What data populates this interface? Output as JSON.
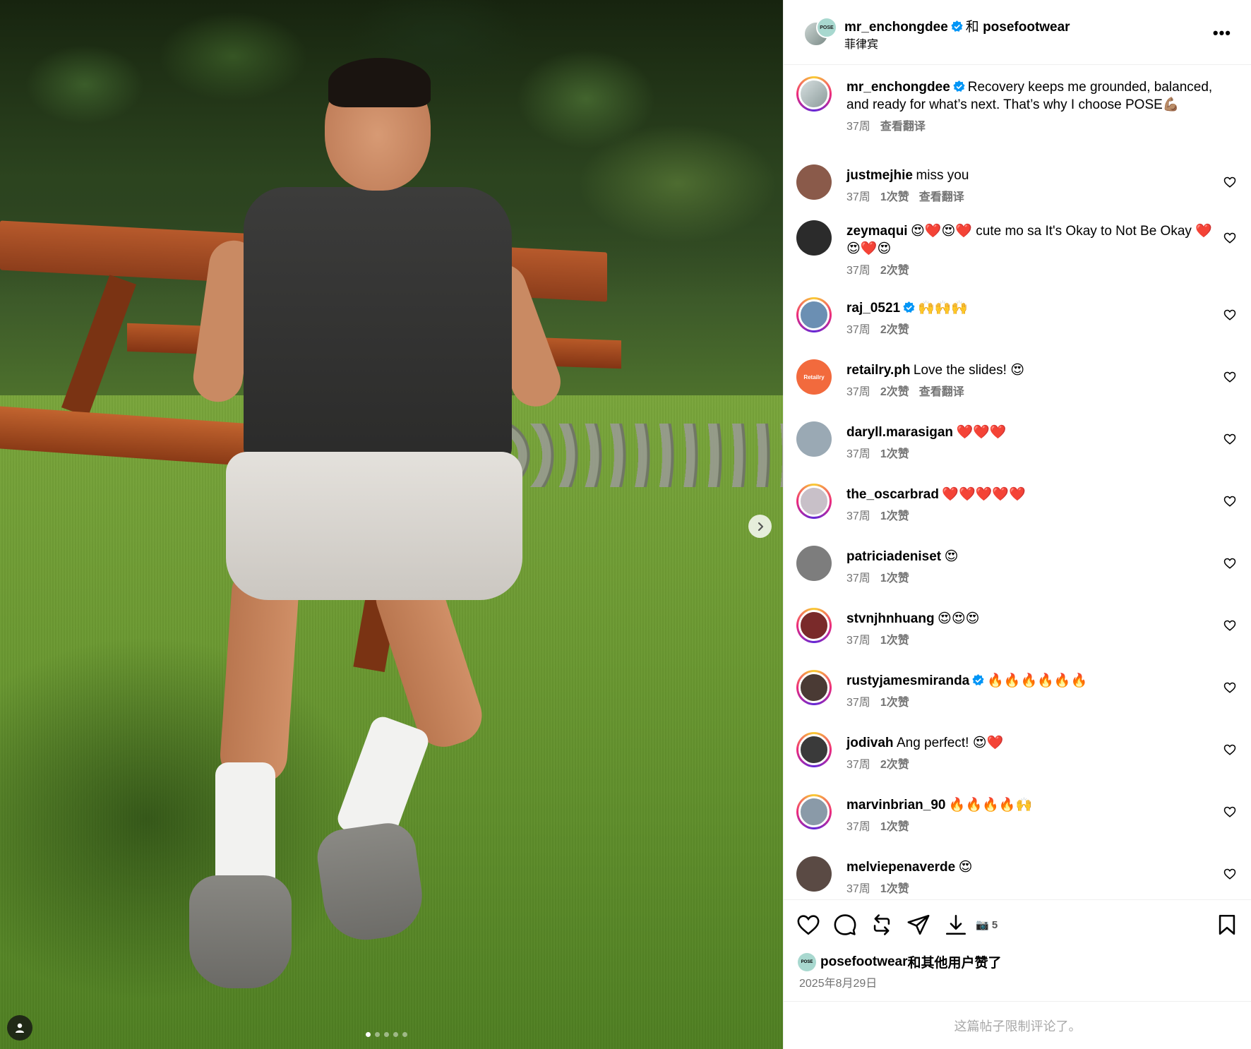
{
  "post": {
    "author": "mr_enchongdee",
    "joiner": "和",
    "collab": "posefootwear",
    "location": "菲律宾",
    "collab_avatar_text": "POSE",
    "more_label": "•••"
  },
  "caption": {
    "user": "mr_enchongdee",
    "text": "Recovery keeps me grounded, balanced, and ready for what’s next. That’s why I choose POSE💪🏽",
    "time": "37周",
    "translate": "查看翻译"
  },
  "comments": [
    {
      "user": "justmejhie",
      "text": "miss you",
      "time": "37周",
      "likes": "1次赞",
      "translate": "查看翻译",
      "verified": false,
      "avatar_color": "#8a5a4a"
    },
    {
      "user": "zeymaqui",
      "text": "😍❤️😍❤️ cute mo sa It's Okay to Not Be Okay ❤️😍❤️😍",
      "time": "37周",
      "likes": "2次赞",
      "translate": "",
      "verified": false,
      "avatar_color": "#2b2b2b"
    },
    {
      "user": "raj_0521",
      "text": "🙌🙌🙌",
      "time": "37周",
      "likes": "2次赞",
      "translate": "",
      "verified": true,
      "avatar_color": "#6b8fb3"
    },
    {
      "user": "retailry.ph",
      "text": "Love the slides! 😍",
      "time": "37周",
      "likes": "2次赞",
      "translate": "查看翻译",
      "verified": false,
      "avatar_color": "#f26a3d",
      "avatar_text": "Retailry"
    },
    {
      "user": "daryll.marasigan",
      "text": "❤️❤️❤️",
      "time": "37周",
      "likes": "1次赞",
      "translate": "",
      "verified": false,
      "avatar_color": "#9aa9b4"
    },
    {
      "user": "the_oscarbrad",
      "text": "❤️❤️❤️❤️❤️",
      "time": "37周",
      "likes": "1次赞",
      "translate": "",
      "verified": false,
      "avatar_color": "#c8c0c8"
    },
    {
      "user": "patriciadeniset",
      "text": "😍",
      "time": "37周",
      "likes": "1次赞",
      "translate": "",
      "verified": false,
      "avatar_color": "#7d7d7d"
    },
    {
      "user": "stvnjhnhuang",
      "text": "😍😍😍",
      "time": "37周",
      "likes": "1次赞",
      "translate": "",
      "verified": false,
      "avatar_color": "#7a2a2a"
    },
    {
      "user": "rustyjamesmiranda",
      "text": "🔥🔥🔥🔥🔥🔥",
      "time": "37周",
      "likes": "1次赞",
      "translate": "",
      "verified": true,
      "avatar_color": "#4a3a34"
    },
    {
      "user": "jodivah",
      "text": "Ang perfect! 😍❤️",
      "time": "37周",
      "likes": "2次赞",
      "translate": "",
      "verified": false,
      "avatar_color": "#3a3a3a"
    },
    {
      "user": "marvinbrian_90",
      "text": "🔥🔥🔥🔥🙌",
      "time": "37周",
      "likes": "1次赞",
      "translate": "",
      "verified": false,
      "avatar_color": "#8a9aa8"
    },
    {
      "user": "melviepenaverde",
      "text": "😍",
      "time": "37周",
      "likes": "1次赞",
      "translate": "",
      "verified": false,
      "avatar_color": "#5a4a44"
    }
  ],
  "actions": {
    "camera_count": "5",
    "liked_by_user": "posefootwear",
    "liked_by_suffix": "和其他用户赞了",
    "date": "2025年8月29日"
  },
  "restricted_notice": "这篇帖子限制评论了。",
  "carousel": {
    "count": 5,
    "active_index": 0
  }
}
